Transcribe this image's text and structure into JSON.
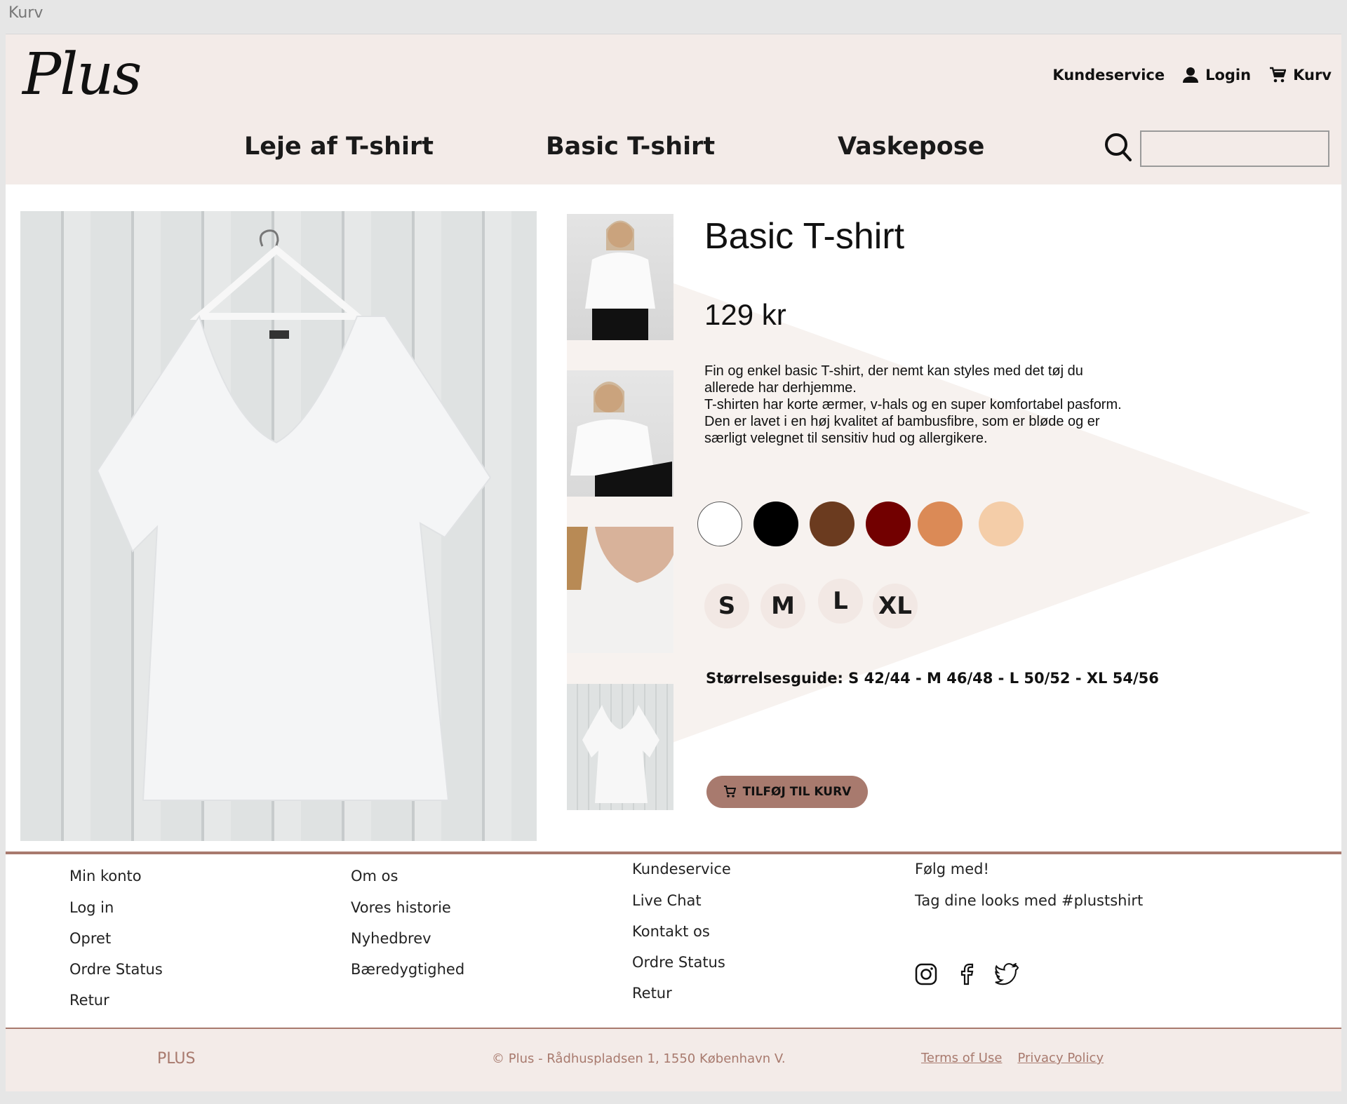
{
  "window": {
    "title": "Kurv"
  },
  "header": {
    "logo": "Plus",
    "top_links": {
      "customer_service": "Kundeservice",
      "login": "Login",
      "cart": "Kurv"
    },
    "nav": [
      "Leje af T-shirt",
      "Basic T-shirt",
      "Vaskepose"
    ],
    "search": {
      "placeholder": "",
      "value": ""
    }
  },
  "product": {
    "title": "Basic T-shirt",
    "price": "129 kr",
    "description": [
      "Fin og enkel basic T-shirt, der nemt kan styles med det tøj du allerede har derhjemme.",
      "T-shirten har korte ærmer, v-hals og en super komfortabel pasform. Den er lavet i en høj kvalitet af bambusfibre, som er bløde og er særligt velegnet til sensitiv hud og allergikere."
    ],
    "colors": [
      "#ffffff",
      "#000000",
      "#6b3b1f",
      "#720000",
      "#db8a56",
      "#f4cda8"
    ],
    "sizes": [
      "S",
      "M",
      "L",
      "XL"
    ],
    "size_guide": "Størrelsesguide: S 42/44 - M 46/48 - L 50/52 - XL 54/56",
    "add_to_cart": "TILFØJ TIL KURV"
  },
  "footer": {
    "columns": [
      {
        "head": "Min konto",
        "items": [
          "Log in",
          "Opret",
          "Ordre Status",
          "Retur"
        ]
      },
      {
        "head": "Om os",
        "items": [
          "Vores historie",
          "Nyhedbrev",
          "Bæredygtighed"
        ]
      },
      {
        "head": "Kundeservice",
        "items": [
          "Live Chat",
          "Kontakt os",
          "Ordre Status",
          "Retur"
        ]
      },
      {
        "head": "Følg med!",
        "items": [
          "Tag dine looks med #plustshirt"
        ]
      }
    ],
    "social_icons": [
      "instagram-icon",
      "facebook-icon",
      "twitter-icon"
    ],
    "brand": "PLUS",
    "copyright": "© Plus - Rådhuspladsen 1, 1550 København V.",
    "links": [
      "Terms of Use",
      "Privacy Policy"
    ]
  }
}
